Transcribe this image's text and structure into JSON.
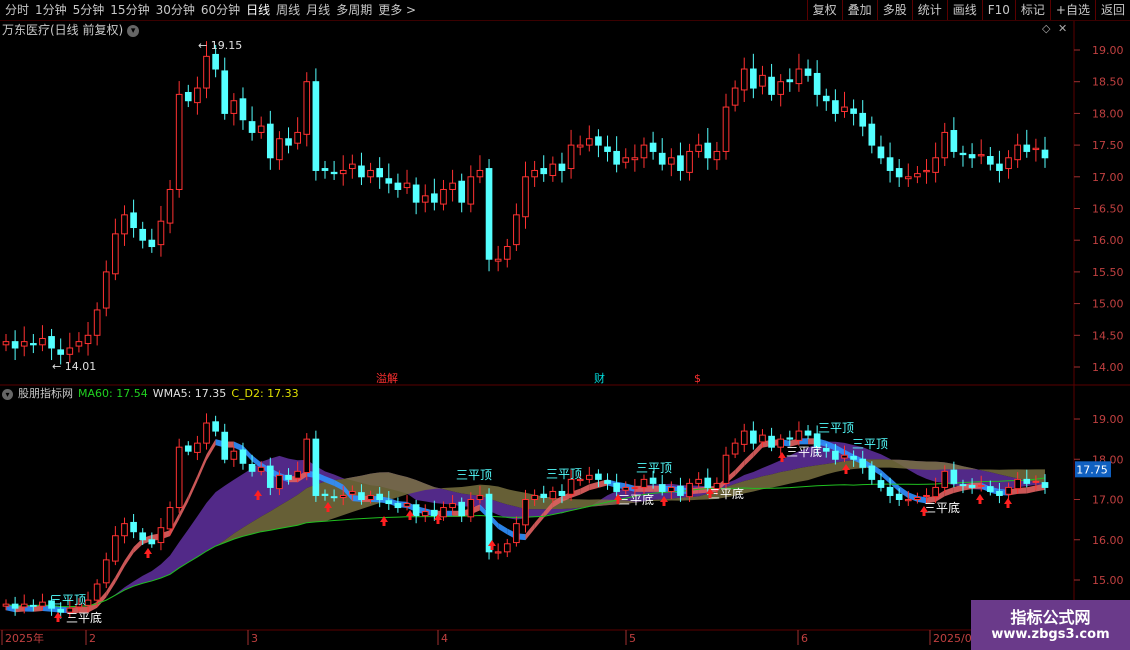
{
  "toolbar": {
    "periods": [
      "分时",
      "1分钟",
      "5分钟",
      "15分钟",
      "30分钟",
      "60分钟",
      "日线",
      "周线",
      "月线",
      "多周期",
      "更多 >"
    ],
    "active_period": "日线",
    "right_buttons": [
      "复权",
      "叠加",
      "多股",
      "统计",
      "画线",
      "F10",
      "标记",
      "+自选",
      "返回"
    ]
  },
  "main_chart": {
    "title": "万东医疗(日线 前复权)",
    "axis_ticks": [
      "19.00",
      "18.50",
      "18.00",
      "17.50",
      "17.00",
      "16.50",
      "16.00",
      "15.50",
      "15.00",
      "14.50",
      "14.00"
    ],
    "high_label": "19.15",
    "low_label": "14.01",
    "markers": [
      {
        "text": "溢解",
        "color": "#ff3030"
      },
      {
        "text": "财",
        "color": "#00dcdc"
      },
      {
        "text": "$",
        "color": "#ff3030"
      }
    ]
  },
  "indicator": {
    "name": "股朋指标网",
    "values": [
      {
        "label": "MA60: 17.54",
        "color": "#20d020"
      },
      {
        "label": "WMA5: 17.35",
        "color": "#e0e0e0"
      },
      {
        "label": "C_D2: 17.33",
        "color": "#e0e000"
      }
    ],
    "axis_ticks": [
      "19.00",
      "18.00",
      "17.00",
      "16.00",
      "15.00"
    ],
    "current_price": "17.75",
    "signals": {
      "top": "三平顶",
      "bottom": "三平底"
    }
  },
  "date_axis": [
    "2025年",
    "2",
    "3",
    "4",
    "5",
    "6",
    "2025/0"
  ],
  "watermark": {
    "line1": "指标公式网",
    "line2": "www.zbgs3.com"
  },
  "colors": {
    "up": "#ff3232",
    "down": "#54ffff",
    "grid": "#5a0000",
    "ma60": "#20c020",
    "band_purple": "#6030a0",
    "band_olive": "#787040",
    "ribbon_red": "#e06060",
    "ribbon_blue": "#3090ff"
  },
  "chart_data": {
    "type": "candlestick",
    "title": "万东医疗(日线 前复权)",
    "ylim": [
      13.9,
      19.3
    ],
    "closes": [
      14.4,
      14.3,
      14.4,
      14.35,
      14.45,
      14.3,
      14.2,
      14.3,
      14.4,
      14.5,
      14.9,
      15.5,
      16.1,
      16.4,
      16.2,
      16.0,
      15.9,
      16.3,
      16.8,
      18.3,
      18.2,
      18.4,
      18.9,
      18.7,
      18.0,
      18.2,
      17.9,
      17.7,
      17.8,
      17.3,
      17.6,
      17.5,
      17.7,
      18.5,
      17.1,
      17.1,
      17.05,
      17.1,
      17.2,
      17.0,
      17.1,
      17.0,
      16.9,
      16.8,
      16.9,
      16.6,
      16.7,
      16.6,
      16.8,
      16.9,
      16.6,
      17.0,
      17.1,
      15.7,
      15.7,
      15.9,
      16.4,
      17.0,
      17.1,
      17.05,
      17.2,
      17.1,
      17.5,
      17.5,
      17.6,
      17.5,
      17.4,
      17.2,
      17.3,
      17.3,
      17.5,
      17.4,
      17.2,
      17.3,
      17.1,
      17.4,
      17.5,
      17.3,
      17.4,
      18.1,
      18.4,
      18.7,
      18.4,
      18.6,
      18.3,
      18.5,
      18.5,
      18.7,
      18.6,
      18.3,
      18.2,
      18.0,
      18.1,
      18.0,
      17.8,
      17.5,
      17.3,
      17.1,
      17.0,
      17.0,
      17.05,
      17.1,
      17.3,
      17.7,
      17.4,
      17.35,
      17.3,
      17.35,
      17.2,
      17.1,
      17.3,
      17.5,
      17.4,
      17.45,
      17.3
    ]
  }
}
